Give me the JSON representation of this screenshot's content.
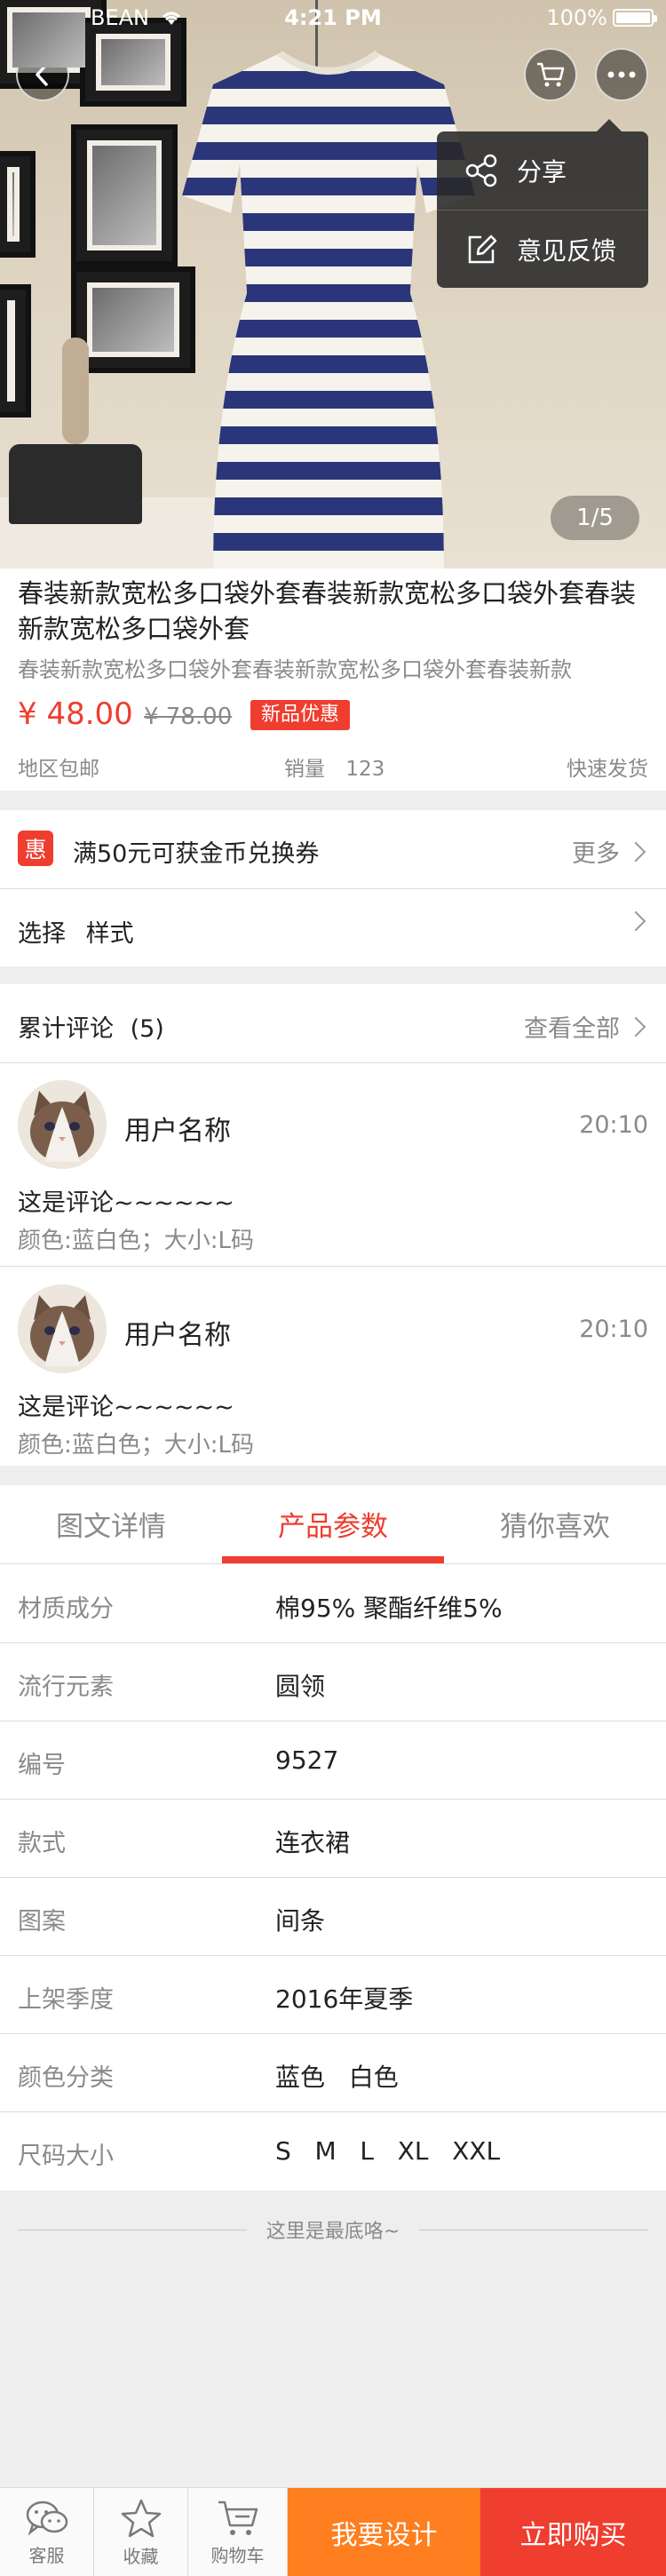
{
  "status_bar": {
    "carrier": "BEAN",
    "time": "4:21 PM",
    "battery": "100%"
  },
  "gallery": {
    "counter": "1/5"
  },
  "menu": {
    "share": "分享",
    "feedback": "意见反馈"
  },
  "product": {
    "title": "春装新款宽松多口袋外套春装新款宽松多口袋外套春装新款宽松多口袋外套",
    "subtitle": "春装新款宽松多口袋外套春装新款宽松多口袋外套春装新款",
    "price": "¥ 48.00",
    "original_price": "¥ 78.00",
    "badge": "新品优惠",
    "shipping_region": "地区包邮",
    "sales_label": "销量",
    "sales_count": "123",
    "delivery": "快速发货"
  },
  "promo": {
    "icon_text": "惠",
    "text": "满50元可获金币兑换券",
    "more": "更多"
  },
  "options": {
    "label": "选择",
    "value": "样式"
  },
  "reviews": {
    "header": "累计评论",
    "count": "(5)",
    "view_all": "查看全部",
    "items": [
      {
        "user": "用户名称",
        "time": "20:10",
        "text": "这是评论~~~~~~",
        "spec": "颜色:蓝白色；大小:L码"
      },
      {
        "user": "用户名称",
        "time": "20:10",
        "text": "这是评论~~~~~~",
        "spec": "颜色:蓝白色；大小:L码"
      }
    ]
  },
  "tabs": [
    {
      "label": "图文详情"
    },
    {
      "label": "产品参数"
    },
    {
      "label": "猜你喜欢"
    }
  ],
  "active_tab": 1,
  "params": [
    {
      "label": "材质成分",
      "value": "棉95% 聚酯纤维5%"
    },
    {
      "label": "流行元素",
      "value": "圆领"
    },
    {
      "label": "编号",
      "value": "9527"
    },
    {
      "label": "款式",
      "value": "连衣裙"
    },
    {
      "label": "图案",
      "value": "间条"
    },
    {
      "label": "上架季度",
      "value": "2016年夏季"
    },
    {
      "label": "颜色分类",
      "value": "蓝色   白色"
    },
    {
      "label": "尺码大小",
      "value": "S   M   L   XL   XXL"
    }
  ],
  "end_text": "这里是最底咯~",
  "bottom_bar": {
    "service": "客服",
    "favorite": "收藏",
    "cart": "购物车",
    "design": "我要设计",
    "buy": "立即购买"
  },
  "colors": {
    "accent": "#ef3d2f",
    "design_button": "#ff7e1f",
    "buy_button": "#ef3d2f"
  }
}
